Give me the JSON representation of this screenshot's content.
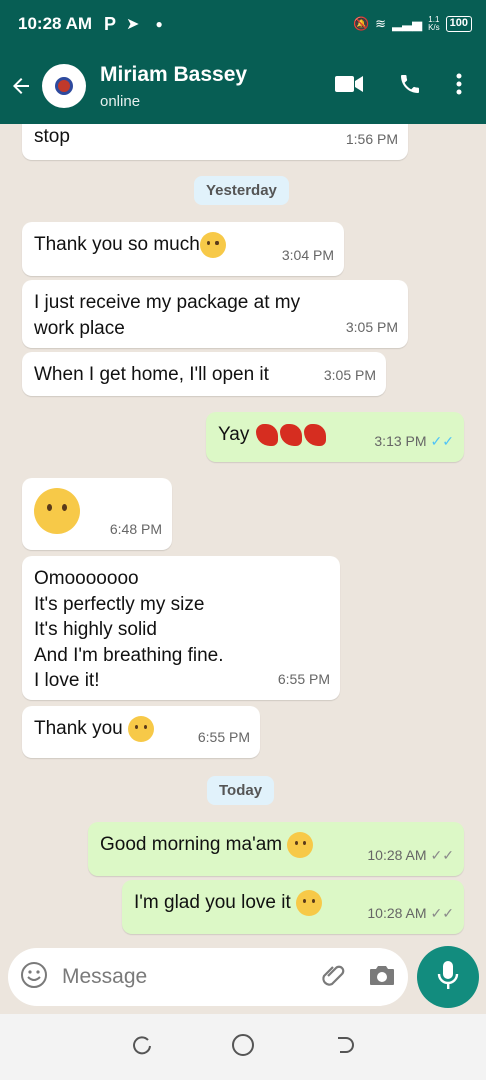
{
  "statusbar": {
    "time": "10:28 AM",
    "p_icon": "P",
    "battery": "100",
    "net_top": "1.1",
    "net_bottom": "K/s"
  },
  "appbar": {
    "contact_name": "Miriam Bassey",
    "contact_status": "online"
  },
  "messages": [
    {
      "dir": "in",
      "text": "stop",
      "time": "1:56 PM"
    },
    {
      "type": "date",
      "text": "Yesterday"
    },
    {
      "dir": "in",
      "text": "Thank you so much",
      "time": "3:04 PM"
    },
    {
      "dir": "in",
      "text": "I just receive my package at my work place",
      "time": "3:05 PM"
    },
    {
      "dir": "in",
      "text": "When I get home, I'll open it",
      "time": "3:05 PM"
    },
    {
      "dir": "out",
      "text": "Yay",
      "time": "3:13 PM",
      "read": true
    },
    {
      "dir": "in",
      "text": "",
      "time": "6:48 PM"
    },
    {
      "dir": "in",
      "lines": [
        "Omooooooo",
        "It's perfectly my size",
        "It's highly solid",
        "And I'm breathing fine.",
        "I love it!"
      ],
      "time": "6:55 PM"
    },
    {
      "dir": "in",
      "text": "Thank you",
      "time": "6:55 PM"
    },
    {
      "type": "date",
      "text": "Today"
    },
    {
      "dir": "out",
      "text": "Good morning ma'am",
      "time": "10:28 AM",
      "read": false
    },
    {
      "dir": "out",
      "text": "I'm glad you love it",
      "time": "10:28 AM",
      "read": false
    }
  ],
  "composer": {
    "placeholder": "Message"
  },
  "colors": {
    "header": "#075e54",
    "outgoing": "#dcf8c6",
    "incoming": "#ffffff",
    "mic": "#128c7e",
    "read_tick": "#4fc3f7"
  }
}
